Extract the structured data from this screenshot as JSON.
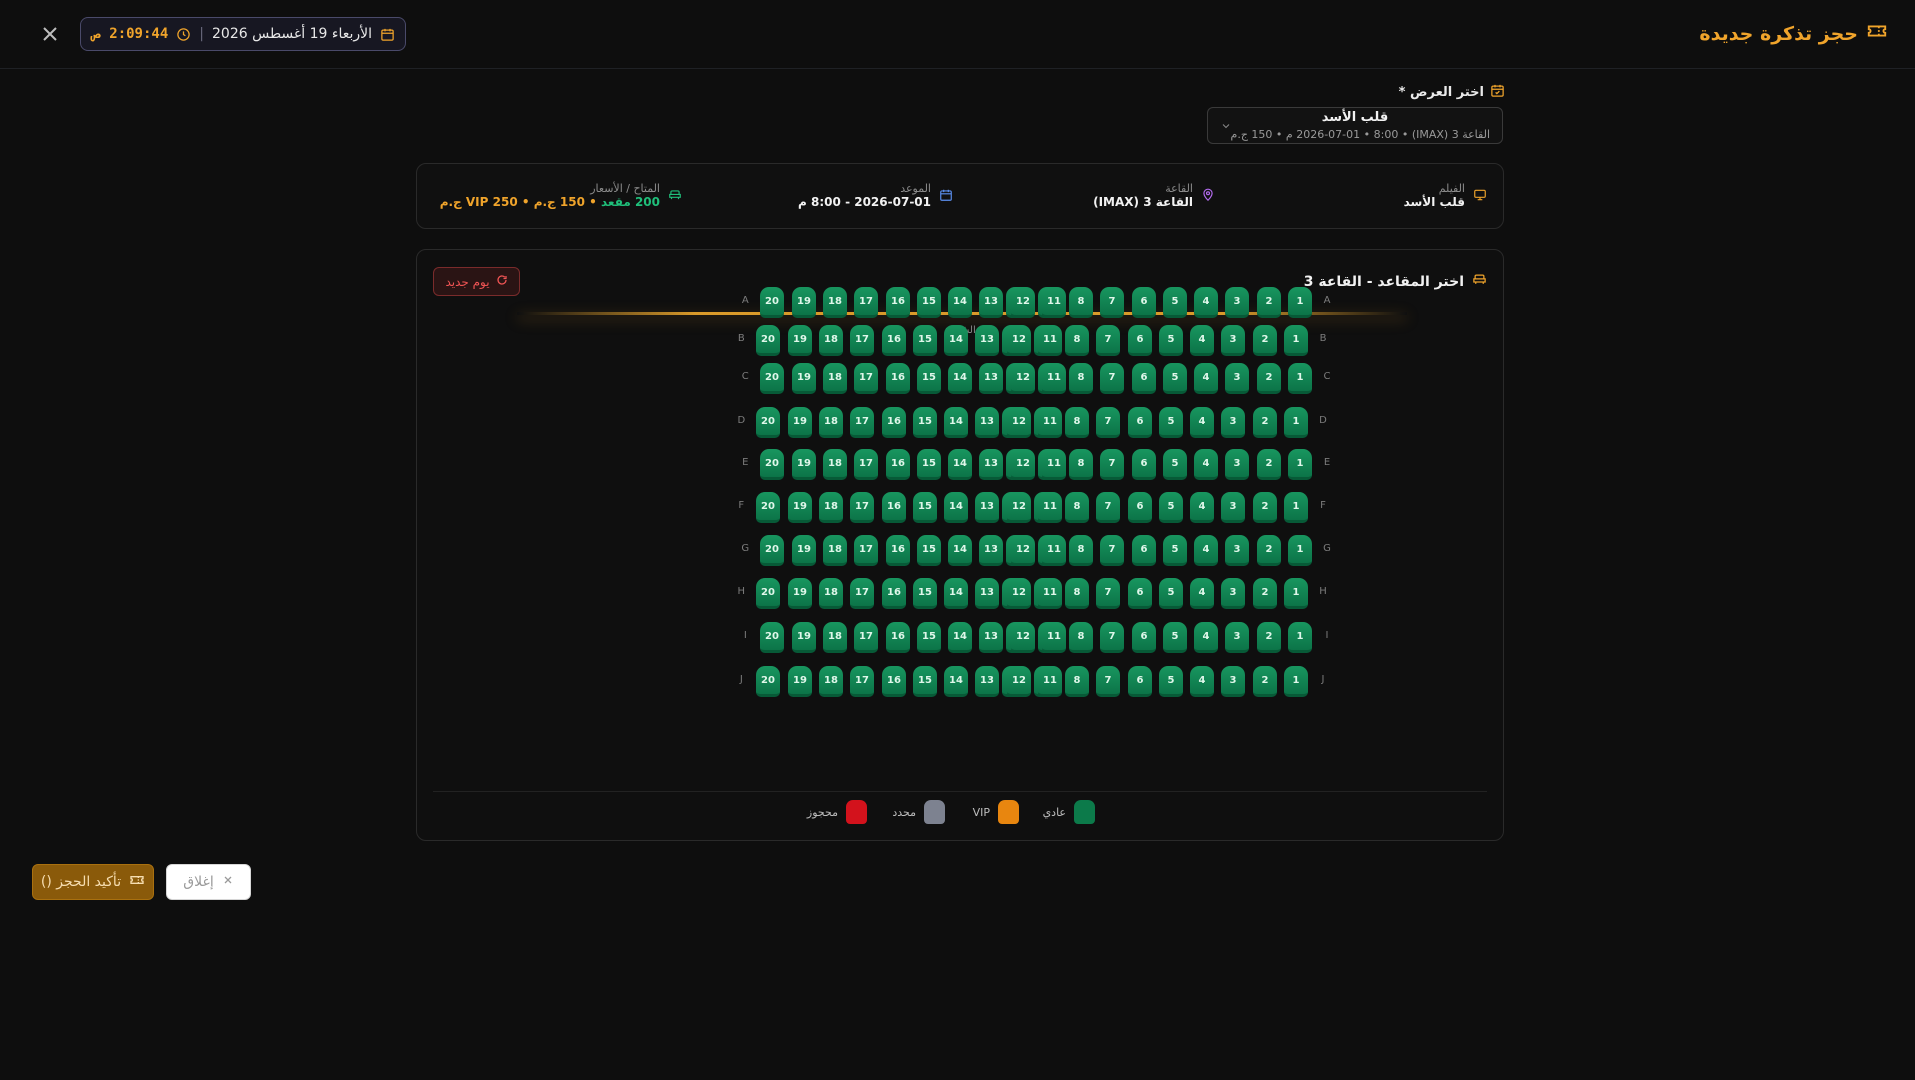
{
  "header": {
    "title": "حجز تذكرة جديدة",
    "date": "الأربعاء 19 أغسطس 2026",
    "separator": "|",
    "time": "2:09:44 ص",
    "accent": "#f0a42b"
  },
  "show_select": {
    "label": "اختر العرض *",
    "selected_title": "قلب الأسد",
    "selected_details": "القاعة 3 (IMAX) • 2026-07-01 • 8:00 م • 150 ج.م"
  },
  "info": {
    "film_label": "الفيلم",
    "film_value": "قلب الأسد",
    "hall_label": "القاعة",
    "hall_value": "القاعة 3 (IMAX)",
    "time_label": "الموعد",
    "time_value": "2026-07-01 - 8:00 م",
    "avail_label": "المتاح / الأسعار",
    "avail_count": "200 مقعد",
    "dot1": " • ",
    "regular_price": "150 ج.م",
    "dot2": " • ",
    "vip_price": "VIP 250 ج.م"
  },
  "seats": {
    "title": "اختر المقاعد - القاعة 3",
    "new_day": "يوم جديد",
    "screen_label": "الشاشة",
    "rows": [
      "A",
      "B",
      "C",
      "D",
      "E",
      "F",
      "G",
      "H",
      "I",
      "J"
    ],
    "seats_per_row": 20,
    "colors": {
      "regular": "#0c7a4a",
      "vip": "#e8860f",
      "selected": "#7d8290",
      "booked": "#d3121c"
    }
  },
  "legend": {
    "regular": "عادي",
    "vip": "VIP",
    "selected": "محدد",
    "booked": "محجوز"
  },
  "footer": {
    "confirm": "تأكيد الحجز ()",
    "close": "إغلاق"
  }
}
